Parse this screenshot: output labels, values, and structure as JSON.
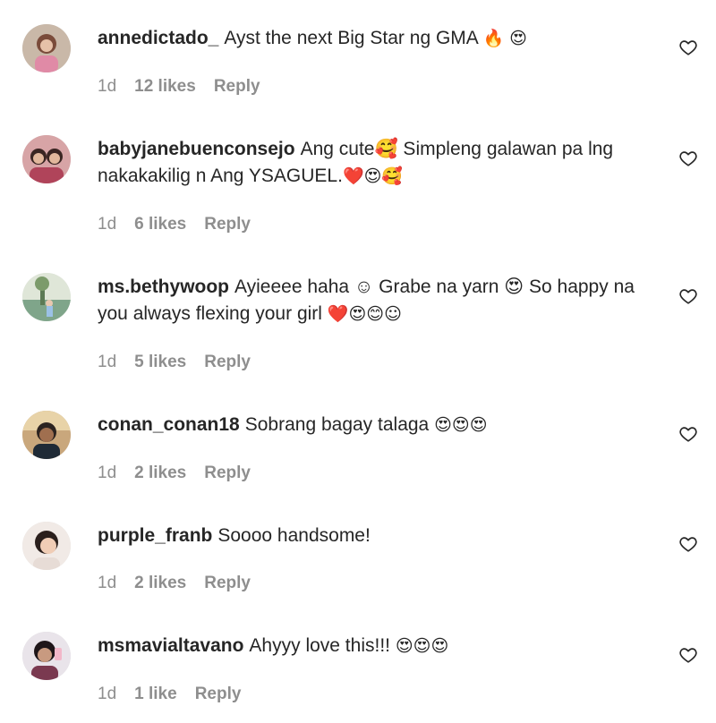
{
  "comments": [
    {
      "username": "annedictado_",
      "text": "Ayst the next Big Star ng GMA",
      "emojis": "🔥 😍",
      "age": "1d",
      "likes": "12 likes",
      "reply": "Reply"
    },
    {
      "username": "babyjanebuenconsejo",
      "text": "Ang cute🥰 Simpleng galawan pa lng nakakakilig n Ang YSAGUEL.",
      "emojis": "❤️😍🥰",
      "age": "1d",
      "likes": "6 likes",
      "reply": "Reply"
    },
    {
      "username": "ms.bethywoop",
      "text": "Ayieeee haha ☺ Grabe na yarn 😍 So happy na you always flexing your girl",
      "emojis": "❤️😍😊☺",
      "age": "1d",
      "likes": "5 likes",
      "reply": "Reply"
    },
    {
      "username": "conan_conan18",
      "text": "Sobrang bagay talaga",
      "emojis": "😍😍😍",
      "age": "1d",
      "likes": "2 likes",
      "reply": "Reply"
    },
    {
      "username": "purple_franb",
      "text": "Soooo handsome!",
      "emojis": "",
      "age": "1d",
      "likes": "2 likes",
      "reply": "Reply"
    },
    {
      "username": "msmavialtavano",
      "text": "Ahyyy love this!!!",
      "emojis": "😍😍😍",
      "age": "1d",
      "likes": "1 like",
      "reply": "Reply"
    }
  ],
  "icons": {
    "like": "heart-outline-icon",
    "avatar": "user-avatar"
  },
  "colors": {
    "text": "#262626",
    "meta": "#8e8e8e",
    "background": "#ffffff"
  }
}
